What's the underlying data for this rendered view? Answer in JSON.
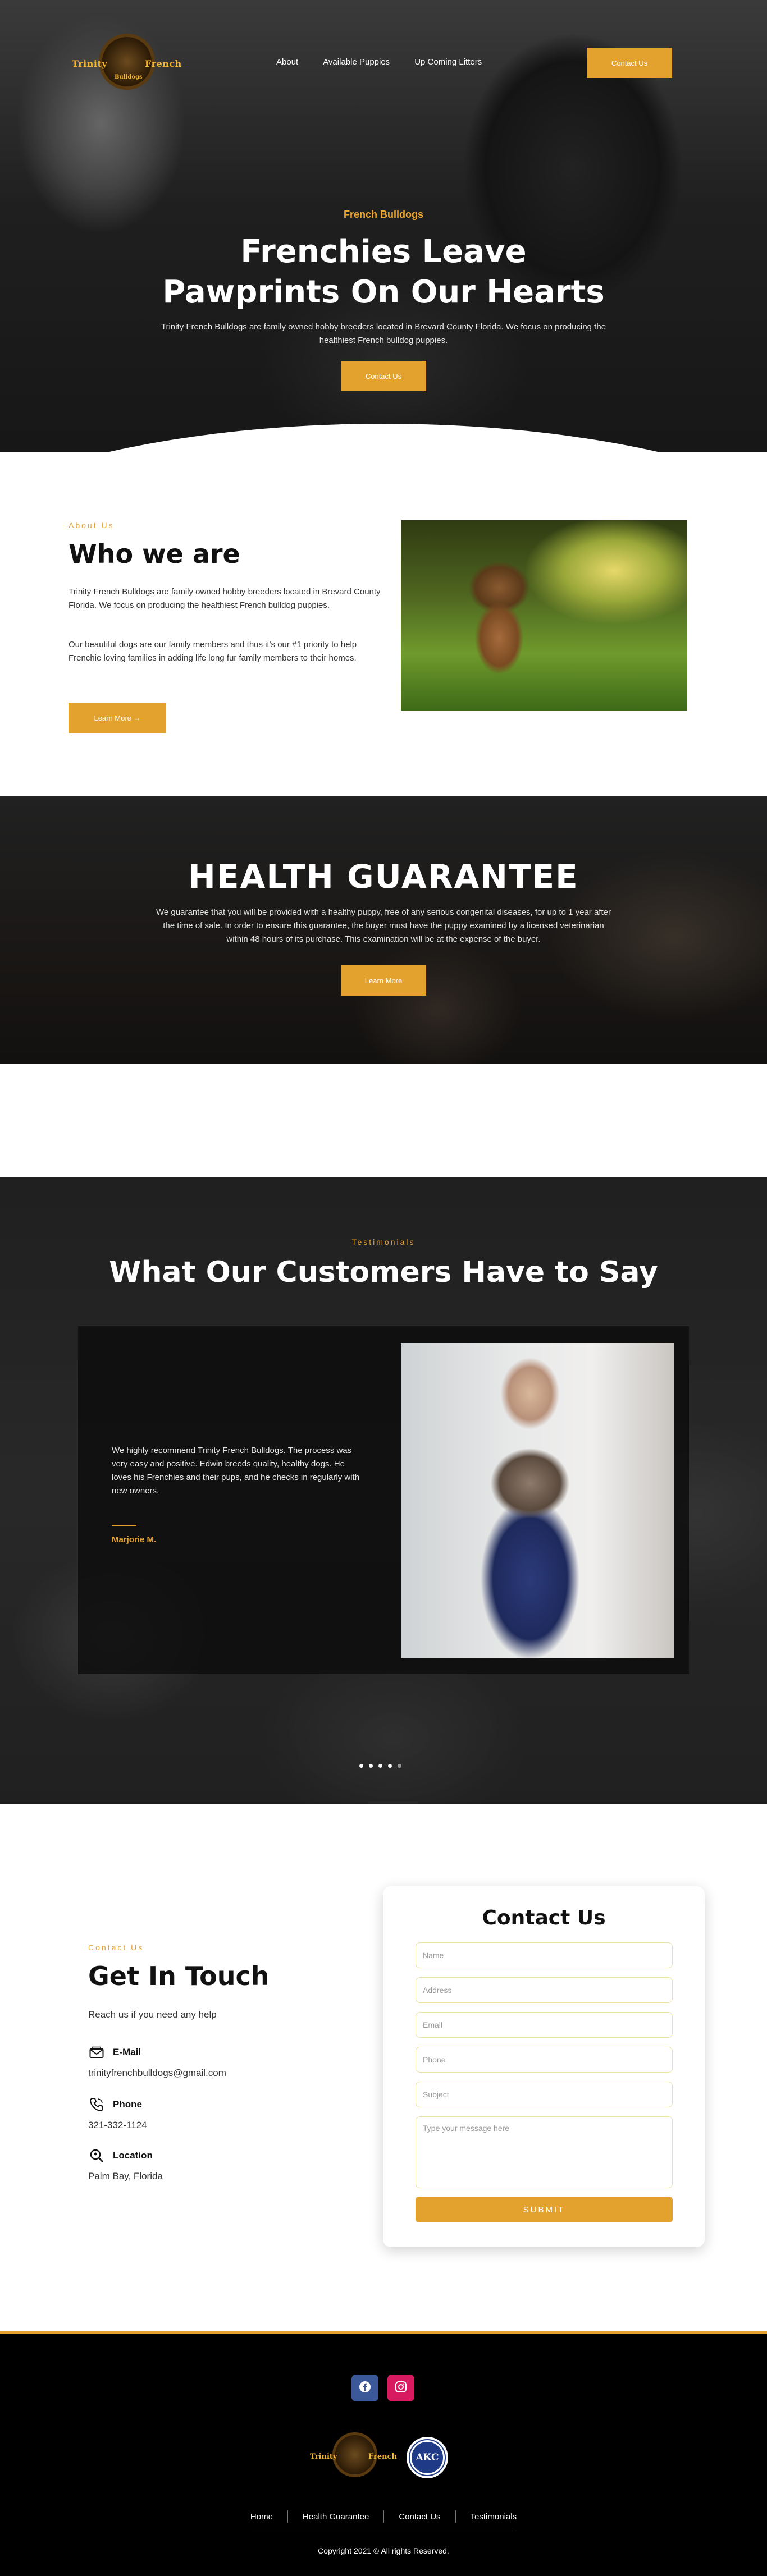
{
  "brand": {
    "logo_left": "Trinity",
    "logo_right": "French",
    "logo_bottom": "Bulldogs"
  },
  "nav": {
    "links": [
      "About",
      "Available Puppies",
      "Up Coming Litters"
    ],
    "cta": "Contact Us"
  },
  "hero": {
    "eyebrow": "French Bulldogs",
    "title_line1": "Frenchies Leave",
    "title_line2": "Pawprints On Our Hearts",
    "text": "Trinity French Bulldogs are family owned hobby breeders located in Brevard County Florida. We focus on producing the healthiest French bulldog puppies.",
    "cta": "Contact Us"
  },
  "about": {
    "eyebrow": "About Us",
    "title": "Who we are",
    "p1": "Trinity French Bulldogs are family owned hobby breeders located in Brevard County Florida. We focus on producing the healthiest French bulldog puppies.",
    "p2": "Our beautiful dogs are our family members and thus it's our #1 priority to help Frenchie loving families in adding life long fur family members to their homes.",
    "button": "Learn More"
  },
  "health": {
    "title": "HEALTH GUARANTEE",
    "text": "We guarantee that you will be provided with a healthy puppy, free of any serious congenital diseases, for up to 1 year after the time of sale. In order to ensure this guarantee, the buyer must have the puppy examined by a licensed veterinarian within 48 hours of its purchase. This examination will be at the expense of the buyer.",
    "button": "Learn More"
  },
  "testimonials": {
    "eyebrow": "Testimonials",
    "title": "What Our Customers Have to Say",
    "quote": "We highly recommend Trinity French Bulldogs. The process was very easy and positive. Edwin breeds quality, healthy dogs. He loves his Frenchies and their pups, and he checks in regularly with new owners.",
    "author": "Marjorie M.",
    "slide_count": 5,
    "active_slide": 4
  },
  "contact": {
    "eyebrow": "Contact Us",
    "title": "Get In Touch",
    "subtitle": "Reach us if you need any help",
    "email_label": "E-Mail",
    "email_value": "trinityfrenchbulldogs@gmail.com",
    "phone_label": "Phone",
    "phone_value": "321-332-1124",
    "location_label": "Location",
    "location_value": "Palm Bay, Florida",
    "form": {
      "title": "Contact Us",
      "name_placeholder": "Name",
      "address_placeholder": "Address",
      "email_placeholder": "Email",
      "phone_placeholder": "Phone",
      "subject_placeholder": "Subject",
      "message_placeholder": "Type your message here",
      "submit": "SUBMIT"
    }
  },
  "footer": {
    "social": [
      "facebook-icon",
      "instagram-icon"
    ],
    "akc_badge": "AKC",
    "links": [
      "Home",
      "Health Guarantee",
      "Contact Us",
      "Testimonials"
    ],
    "copyright": "Copyright 2021 © All rights Reserved."
  },
  "colors": {
    "accent": "#e3a22e",
    "facebook": "#3b5998",
    "instagram": "#d81b60",
    "footer_bg": "#000000"
  }
}
